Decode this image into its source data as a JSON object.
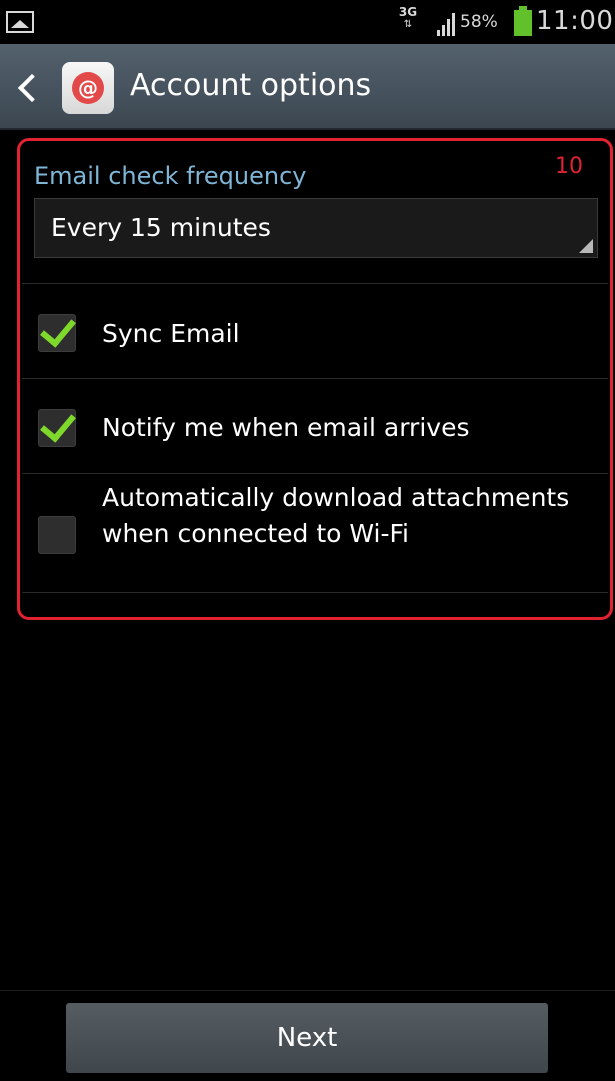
{
  "status_bar": {
    "network": "3G",
    "data_arrows": "⇅",
    "battery": "58%",
    "time": "11:00"
  },
  "action_bar": {
    "title": "Account options"
  },
  "annotation": {
    "number": "10"
  },
  "email_check": {
    "label": "Email check frequency",
    "value": "Every 15 minutes"
  },
  "options": [
    {
      "label": "Sync Email",
      "checked": true
    },
    {
      "label": "Notify me when email arrives",
      "checked": true
    },
    {
      "label": "Automatically download attachments when connected to Wi-Fi",
      "checked": false
    }
  ],
  "footer": {
    "next_label": "Next"
  },
  "colors": {
    "accent_label": "#7fb6d6",
    "check": "#7fd82c",
    "annotation": "#e02231"
  },
  "icons": {
    "gallery": "gallery-icon",
    "signal": "signal-icon",
    "battery": "battery-icon",
    "back": "back-icon",
    "app": "email-app-icon",
    "dropdown": "dropdown-icon",
    "check": "check-icon"
  }
}
